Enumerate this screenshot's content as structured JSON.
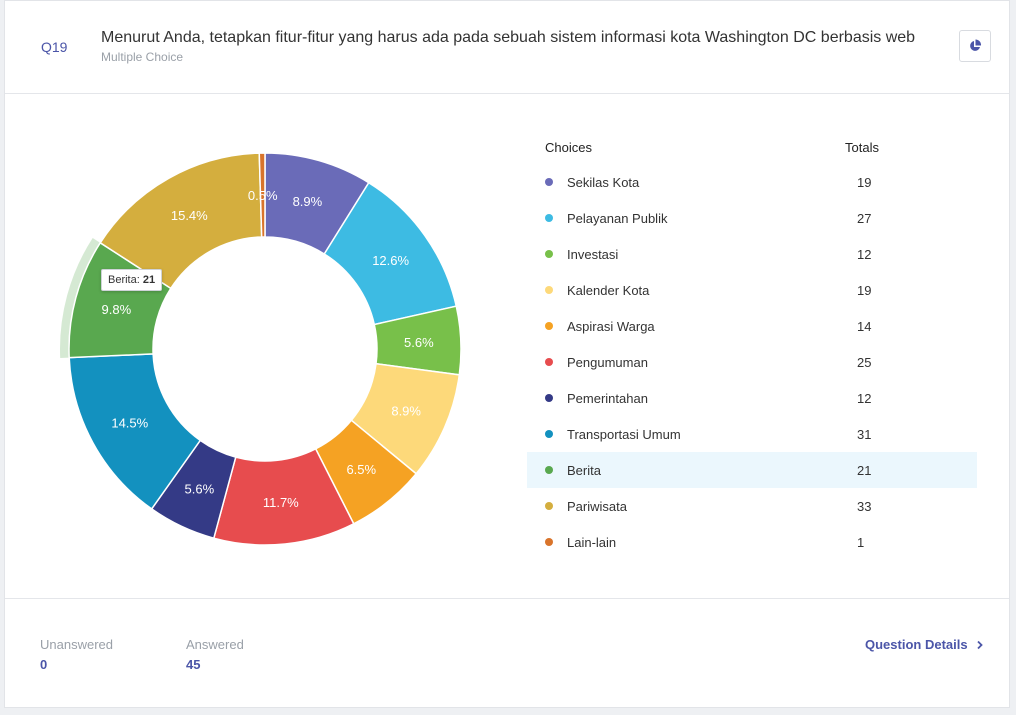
{
  "question": {
    "number": "Q19",
    "title": "Menurut Anda, tetapkan fitur-fitur yang harus ada pada sebuah sistem informasi kota Washington DC berbasis web",
    "type": "Multiple Choice"
  },
  "table": {
    "col_choices": "Choices",
    "col_totals": "Totals",
    "highlighted": "Berita"
  },
  "tooltip": {
    "label": "Berita:",
    "value": "21"
  },
  "footer": {
    "unanswered_label": "Unanswered",
    "unanswered_value": "0",
    "answered_label": "Answered",
    "answered_value": "45",
    "details_label": "Question Details"
  },
  "icons": {
    "chart_toggle": "pie-chart-icon",
    "details_arrow": "chevron-right-icon"
  },
  "chart_data": {
    "type": "pie",
    "donut": true,
    "categories": [
      "Sekilas Kota",
      "Pelayanan Publik",
      "Investasi",
      "Kalender Kota",
      "Aspirasi Warga",
      "Pengumuman",
      "Pemerintahan",
      "Transportasi Umum",
      "Berita",
      "Pariwisata",
      "Lain-lain"
    ],
    "values": [
      19,
      27,
      12,
      19,
      14,
      25,
      12,
      31,
      21,
      33,
      1
    ],
    "labels": [
      "8.9%",
      "12.6%",
      "5.6%",
      "8.9%",
      "6.5%",
      "11.7%",
      "5.6%",
      "14.5%",
      "9.8%",
      "15.4%",
      "0.5%"
    ],
    "colors": [
      "#6a6bb8",
      "#3dbbe3",
      "#78c04a",
      "#fdd97a",
      "#f5a223",
      "#e74c4e",
      "#343a86",
      "#1391bf",
      "#59a84f",
      "#d4ae3e",
      "#d9742b"
    ],
    "highlighted": "Berita"
  }
}
